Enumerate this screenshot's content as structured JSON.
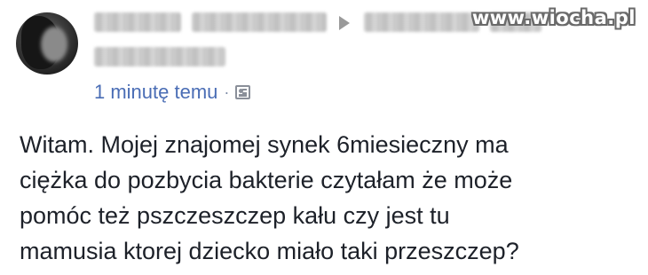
{
  "watermark": "www.wiocha.pl",
  "post": {
    "timestamp": "1 minutę temu",
    "separator": "·",
    "audience_icon": "group-icon",
    "target_arrow_icon": "arrow-right-icon",
    "text_lines": [
      "Witam. Mojej znajomej synek 6miesieczny ma",
      "ciężka do pozbycia bakterie czytałam że może",
      "pomóc też pszczeszczep kału czy jest tu",
      "mamusia ktorej dziecko miało taki przeszczep?"
    ]
  },
  "colors": {
    "link": "#4a6db5",
    "text": "#1d2129",
    "muted": "#8a8f99"
  }
}
